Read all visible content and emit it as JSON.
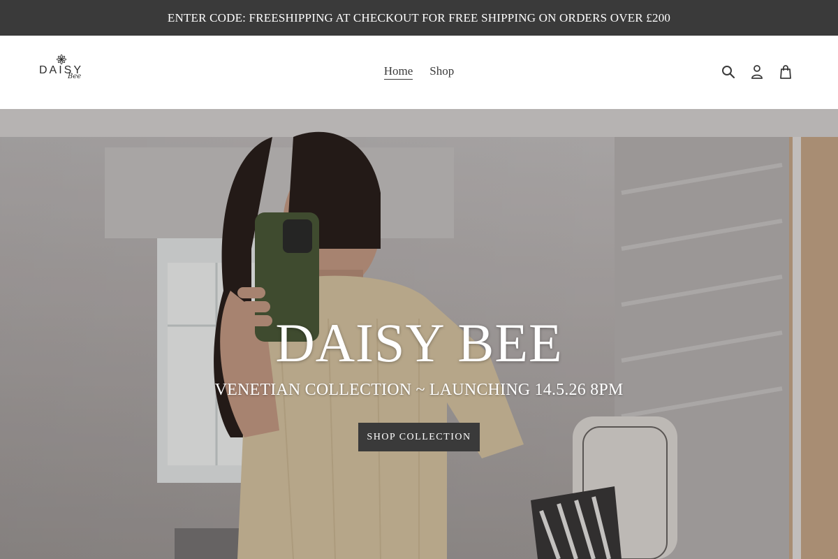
{
  "announcement": {
    "text": "ENTER CODE: FREESHIPPING AT CHECKOUT FOR FREE SHIPPING ON ORDERS OVER £200"
  },
  "logo": {
    "word": "DAISY",
    "script": "Bee"
  },
  "nav": {
    "items": [
      {
        "label": "Home",
        "active": true
      },
      {
        "label": "Shop",
        "active": false
      }
    ]
  },
  "header_icons": [
    "search-icon",
    "account-icon",
    "cart-icon"
  ],
  "hero": {
    "title": "DAISY BEE",
    "subtitle": "VENETIAN COLLECTION ~ LAUNCHING 14.5.26 8PM",
    "button_label": "SHOP COLLECTION"
  },
  "colors": {
    "announcement_bg": "#3a3a3a",
    "button_bg": "#3a3a3a",
    "text_dark": "#3a3a3a"
  }
}
